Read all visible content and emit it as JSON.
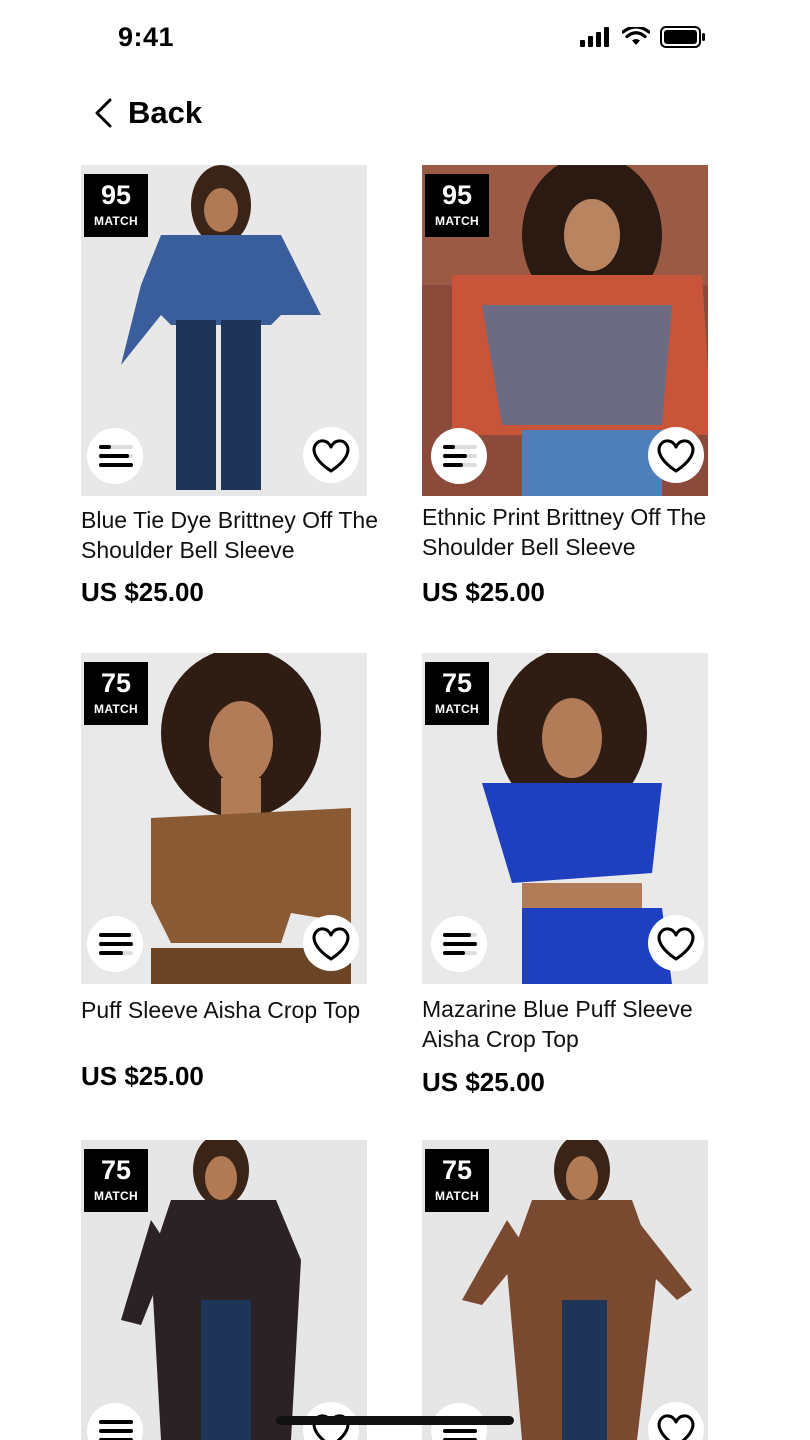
{
  "status_bar": {
    "time": "9:41"
  },
  "nav": {
    "back_label": "Back"
  },
  "products": [
    {
      "match_score": "95",
      "match_label": "MATCH",
      "title": "Blue Tie Dye Brittney Off The Shoulder Bell Sleeve",
      "price": "US $25.00",
      "top_color": "#3a5d9c",
      "bottom_color": "#1f3558"
    },
    {
      "match_score": "95",
      "match_label": "MATCH",
      "title": "Ethnic Print Brittney Off The Shoulder Bell Sleeve",
      "price": "US $25.00",
      "top_color": "#c8553a",
      "bottom_color": "#4f7fb8"
    },
    {
      "match_score": "75",
      "match_label": "MATCH",
      "title": "Puff Sleeve Aisha Crop Top",
      "price": "US $25.00",
      "top_color": "#8a5a34",
      "bottom_color": "#6b4426"
    },
    {
      "match_score": "75",
      "match_label": "MATCH",
      "title": "Mazarine Blue Puff Sleeve Aisha Crop Top",
      "price": "US $25.00",
      "top_color": "#1d3fc0",
      "bottom_color": "#1d3fc0"
    },
    {
      "match_score": "75",
      "match_label": "MATCH",
      "title": "",
      "price": "",
      "top_color": "#2a2224",
      "bottom_color": "#1f3558"
    },
    {
      "match_score": "75",
      "match_label": "MATCH",
      "title": "",
      "price": "",
      "top_color": "#7a4a30",
      "bottom_color": "#1f3558"
    }
  ]
}
